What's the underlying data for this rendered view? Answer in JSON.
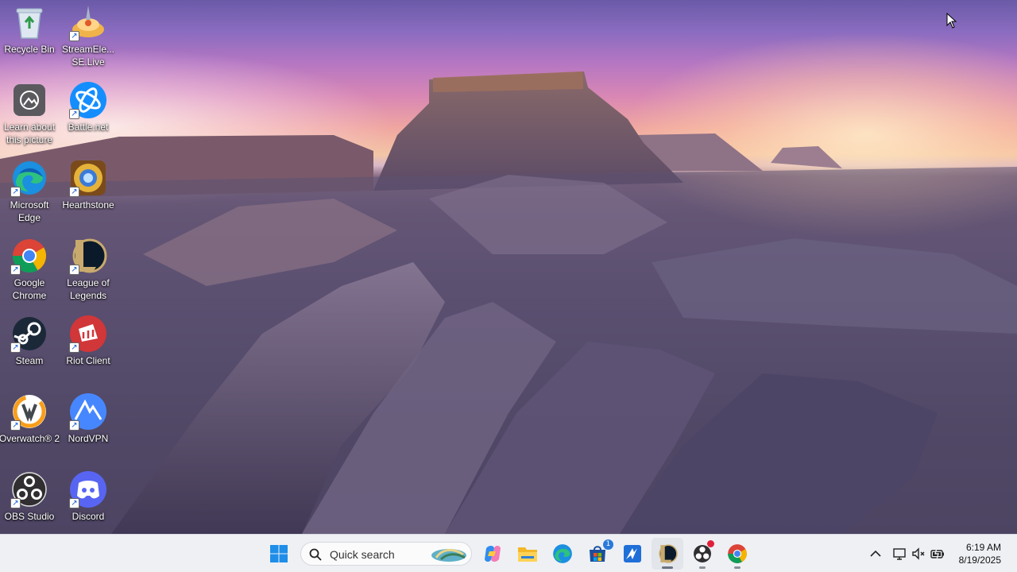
{
  "desktop_icons": [
    {
      "label": "Recycle Bin",
      "icon": "recycle-bin-icon"
    },
    {
      "label": "StreamElements SE.Live",
      "display": "StreamEle...\nSE.Live",
      "icon": "streamelements-icon"
    },
    {
      "label": "Learn about this picture",
      "icon": "learn-picture-icon"
    },
    {
      "label": "Battle.net",
      "icon": "battlenet-icon"
    },
    {
      "label": "Microsoft Edge",
      "icon": "edge-icon"
    },
    {
      "label": "Hearthstone",
      "icon": "hearthstone-icon"
    },
    {
      "label": "Google Chrome",
      "icon": "chrome-icon"
    },
    {
      "label": "League of Legends",
      "icon": "league-of-legends-icon"
    },
    {
      "label": "Steam",
      "icon": "steam-icon"
    },
    {
      "label": "Riot Client",
      "icon": "riot-client-icon"
    },
    {
      "label": "Overwatch® 2",
      "icon": "overwatch-icon"
    },
    {
      "label": "NordVPN",
      "icon": "nordvpn-icon"
    },
    {
      "label": "OBS Studio",
      "icon": "obs-icon"
    },
    {
      "label": "Discord",
      "icon": "discord-icon"
    }
  ],
  "taskbar": {
    "search_placeholder": "Quick search",
    "pinned": [
      {
        "name": "start",
        "icon": "windows-start-icon"
      },
      {
        "name": "copilot",
        "icon": "copilot-icon"
      },
      {
        "name": "file-explorer",
        "icon": "folder-icon"
      },
      {
        "name": "edge",
        "icon": "edge-icon"
      },
      {
        "name": "microsoft-store",
        "icon": "store-icon",
        "badge": "1"
      },
      {
        "name": "vpn",
        "icon": "app-icon"
      },
      {
        "name": "league-of-legends",
        "icon": "league-of-legends-icon"
      },
      {
        "name": "obs",
        "icon": "obs-icon"
      },
      {
        "name": "chrome",
        "icon": "chrome-icon"
      }
    ],
    "tray": {
      "icons": [
        "chevron-up-icon",
        "network-icon",
        "volume-muted-icon",
        "battery-icon"
      ],
      "time": "6:19 AM",
      "date": "8/19/2025"
    }
  },
  "colors": {
    "taskbar_bg": "#eef0f4",
    "accent": "#0078d4"
  }
}
